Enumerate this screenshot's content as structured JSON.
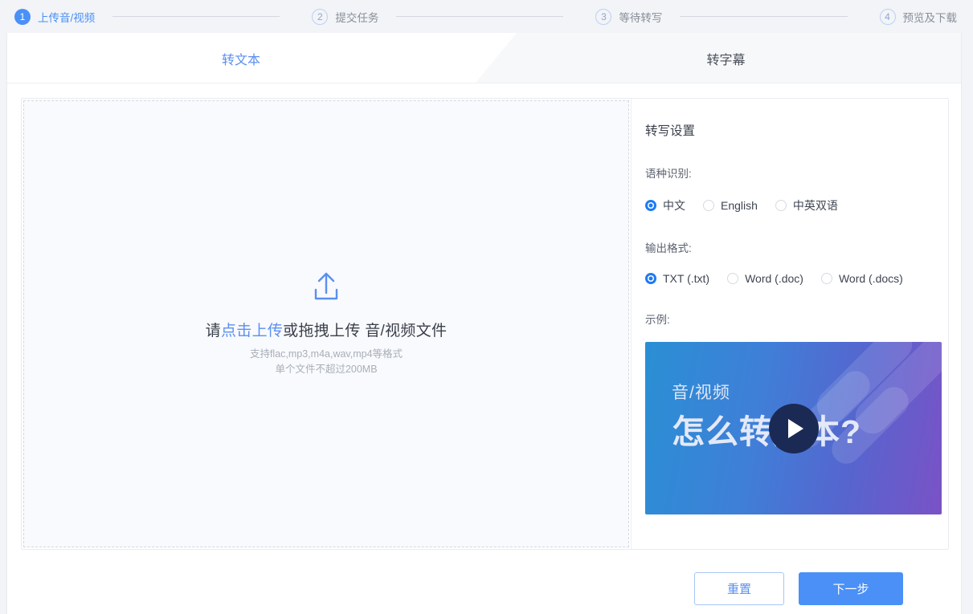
{
  "stepper": {
    "steps": [
      {
        "num": "1",
        "label": "上传音/视频",
        "state": "active"
      },
      {
        "num": "2",
        "label": "提交任务",
        "state": "idle"
      },
      {
        "num": "3",
        "label": "等待转写",
        "state": "idle"
      },
      {
        "num": "4",
        "label": "预览及下载",
        "state": "idle"
      }
    ]
  },
  "tabs": [
    {
      "label": "转文本",
      "active": true
    },
    {
      "label": "转字幕",
      "active": false
    }
  ],
  "upload": {
    "icon": "upload-arrow-icon",
    "prompt_prefix": "请",
    "prompt_link": "点击上传",
    "prompt_suffix": "或拖拽上传 音/视频文件",
    "hint_line_1": "支持flac,mp3,m4a,wav,mp4等格式",
    "hint_line_2": "单个文件不超过200MB"
  },
  "settings": {
    "title": "转写设置",
    "language": {
      "label": "语种识别:",
      "options": [
        {
          "label": "中文",
          "selected": true
        },
        {
          "label": "English",
          "selected": false
        },
        {
          "label": "中英双语",
          "selected": false
        }
      ]
    },
    "output_format": {
      "label": "输出格式:",
      "options": [
        {
          "label": "TXT (.txt)",
          "selected": true
        },
        {
          "label": "Word (.doc)",
          "selected": false
        },
        {
          "label": "Word  (.docs)",
          "selected": false
        }
      ]
    },
    "example": {
      "label": "示例:",
      "thumb_small_text": "音/视频",
      "thumb_big_text": "怎么转文本?",
      "play_icon": "play-icon"
    }
  },
  "footer": {
    "reset_label": "重置",
    "next_label": "下一步"
  },
  "colors": {
    "accent": "#4a90f7",
    "radio_on": "#1d7bf5",
    "link": "#5b8ff0",
    "page_bg": "#f2f4f7",
    "tab_inactive_bg": "#f7f8fa",
    "dropzone_bg": "#f8fafd"
  }
}
